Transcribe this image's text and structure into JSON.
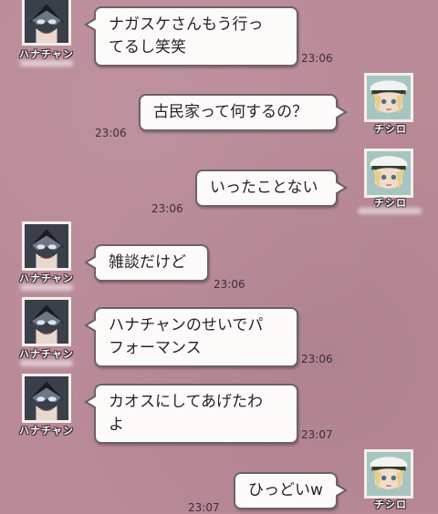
{
  "senders": {
    "hana": {
      "name": "ハナチャン",
      "avatar_icon": "masked-character-avatar-icon"
    },
    "chishiro": {
      "name": "チシロ",
      "avatar_icon": "white-cap-character-avatar-icon"
    }
  },
  "messages": [
    {
      "sender": "hana",
      "lines": [
        "ナガスケさんもう行っ",
        "てるし笑笑"
      ],
      "time": "23:06"
    },
    {
      "sender": "chishiro",
      "lines": [
        "古民家って何するの？"
      ],
      "time": "23:06"
    },
    {
      "sender": "chishiro",
      "lines": [
        "いったことない"
      ],
      "time": "23:06"
    },
    {
      "sender": "hana",
      "lines": [
        "雑談だけど"
      ],
      "time": "23:06"
    },
    {
      "sender": "hana",
      "lines": [
        "ハナチャンのせいでパ",
        "フォーマンス"
      ],
      "time": "23:06"
    },
    {
      "sender": "hana",
      "lines": [
        "カオスにしてあげたわ",
        "よ"
      ],
      "time": "23:07"
    },
    {
      "sender": "chishiro",
      "lines": [
        "ひっどいw"
      ],
      "time": "23:07"
    }
  ],
  "colors": {
    "background": "#b98a97",
    "bubble": "#fcfbfa",
    "bubble_border": "#6c6168"
  }
}
